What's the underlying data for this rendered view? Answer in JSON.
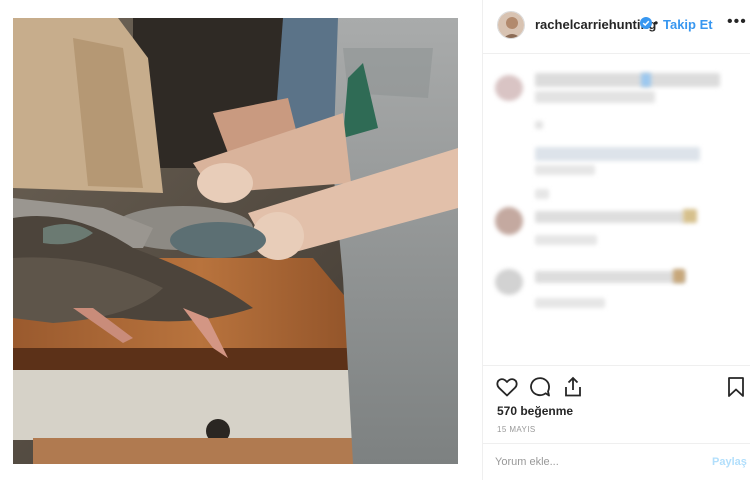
{
  "post": {
    "image_alt": "People preparing birds on a wooden kitchen counter"
  },
  "header": {
    "username": "rachelcarriehunting",
    "verified": true,
    "follow_label": "Takip Et",
    "more_icon": "more-options-icon"
  },
  "comments": {
    "state": "blurred"
  },
  "actions": {
    "icons": [
      "heart-icon",
      "comment-icon",
      "share-icon",
      "bookmark-icon"
    ],
    "likes_text": "570 beğenme",
    "date_text": "15 MAYIS"
  },
  "comment_bar": {
    "placeholder": "Yorum ekle...",
    "post_label": "Paylaş"
  },
  "colors": {
    "accent": "#3897f0",
    "post_disabled": "#b2dffc",
    "divider": "#efefef"
  }
}
